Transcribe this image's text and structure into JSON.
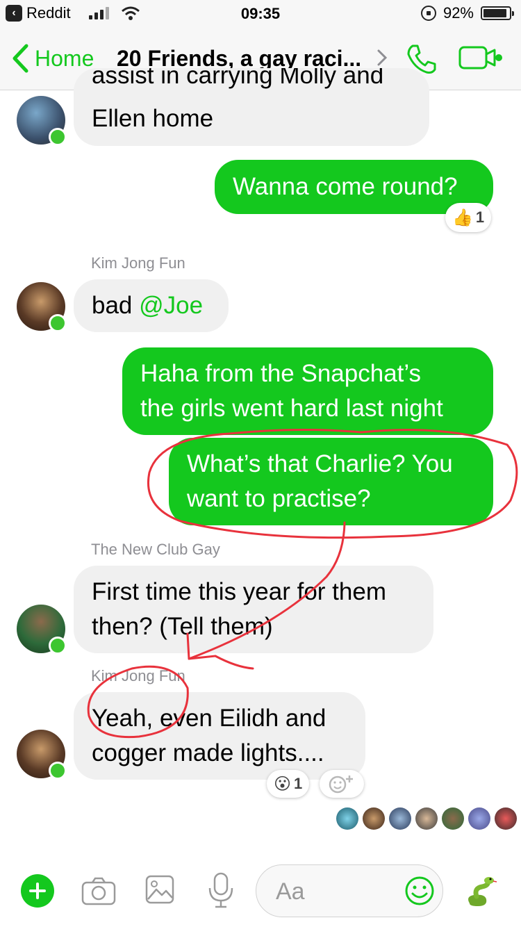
{
  "status_bar": {
    "back_app": "Reddit",
    "time": "09:35",
    "battery": "92%"
  },
  "nav": {
    "back_label": "Home",
    "title": "20 Friends, a gay raci..."
  },
  "messages": {
    "m1_text": "Ellen home",
    "m1_partial": "assist in carrying Molly and",
    "m2_text": "Wanna come round?",
    "m2_reaction_count": "1",
    "m3_sender": "Kim Jong Fun",
    "m3_text": "bad ",
    "m3_mention": "@Joe",
    "m4_line1": "Haha from the Snapchat’s",
    "m4_line2": "the girls went hard last night",
    "m5_line1": "What’s that Charlie? You",
    "m5_line2": "want to practise?",
    "m6_sender": "The New Club Gay",
    "m6_line1": "First time this year for them",
    "m6_line2": "then? (Tell them)",
    "m7_sender": "Kim Jong Fun",
    "m7_line1": "Yeah, even Eilidh and",
    "m7_line2": "cogger made lights....",
    "m7_reaction_count": "1"
  },
  "composer": {
    "placeholder": "Aa"
  },
  "colors": {
    "accent": "#14c81e",
    "incoming_bubble": "#f0f0f0",
    "annotation": "#e8323c"
  },
  "icons": [
    "add-icon",
    "camera-icon",
    "gallery-icon",
    "microphone-icon",
    "emoji-icon",
    "snake-sticker-icon",
    "phone-icon",
    "video-icon",
    "thumbs-up-icon",
    "surprised-face-icon"
  ]
}
